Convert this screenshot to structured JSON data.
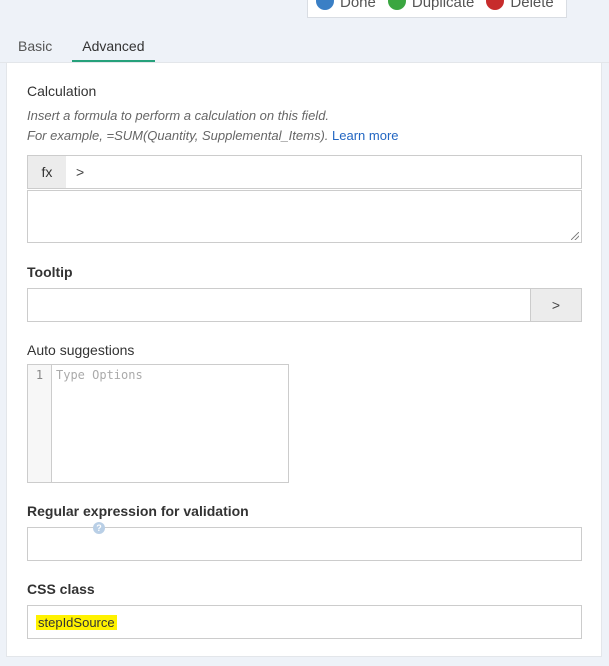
{
  "actions": {
    "done": "Done",
    "duplicate": "Duplicate",
    "delete": "Delete"
  },
  "tabs": [
    {
      "label": "Basic"
    },
    {
      "label": "Advanced"
    }
  ],
  "calculation": {
    "label": "Calculation",
    "hint_line1": "Insert a formula to perform a calculation on this field.",
    "hint_line2": "For example, =SUM(Quantity, Supplemental_Items).",
    "learn_more": "Learn more",
    "fx": "fx",
    "chevron": ">"
  },
  "tooltip": {
    "label": "Tooltip",
    "value": "",
    "button": ">"
  },
  "auto_suggestions": {
    "label": "Auto suggestions",
    "line_number": "1",
    "placeholder": "Type Options"
  },
  "regex": {
    "label": "Regular expression for validation",
    "value": ""
  },
  "css_class": {
    "label": "CSS class",
    "help": "?",
    "value": "stepIdSource"
  }
}
